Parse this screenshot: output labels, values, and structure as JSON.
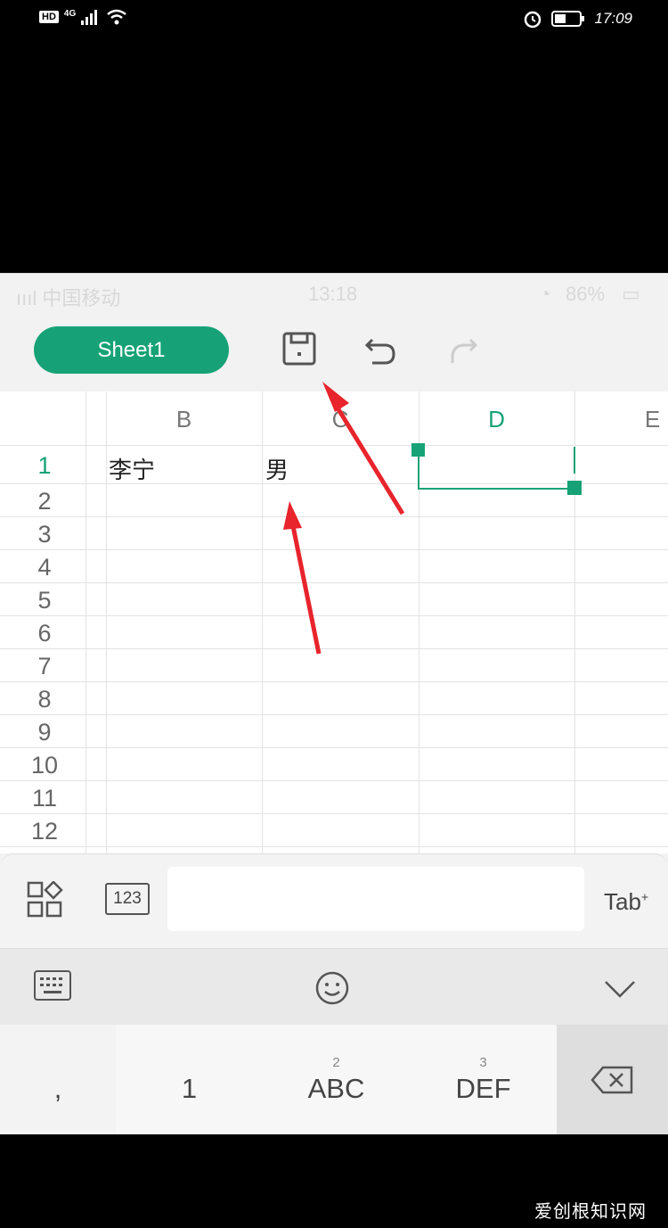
{
  "outer_status": {
    "hd": "HD",
    "network": "4G",
    "time": "17:09"
  },
  "inner_status": {
    "carrier": "中国移动",
    "time": "13:18",
    "battery": "86%"
  },
  "toolbar": {
    "sheet_tab": "Sheet1"
  },
  "columns": [
    "B",
    "C",
    "D",
    "E"
  ],
  "rows": [
    "1",
    "2",
    "3",
    "4",
    "5",
    "6",
    "7",
    "8",
    "9",
    "10",
    "11",
    "12"
  ],
  "cells": {
    "B1": "李宁",
    "C1": "男"
  },
  "selected": {
    "column": "D",
    "row": "1"
  },
  "input_bar": {
    "num_key": "123",
    "tab_key": "Tab"
  },
  "keyboard": {
    "keys": [
      {
        "num": "",
        "label": ","
      },
      {
        "num": "",
        "label": "1"
      },
      {
        "num": "2",
        "label": "ABC"
      },
      {
        "num": "3",
        "label": "DEF"
      }
    ]
  },
  "accent_color": "#16a276",
  "annotation_color": "#e8242c",
  "watermark": "爱创根知识网"
}
